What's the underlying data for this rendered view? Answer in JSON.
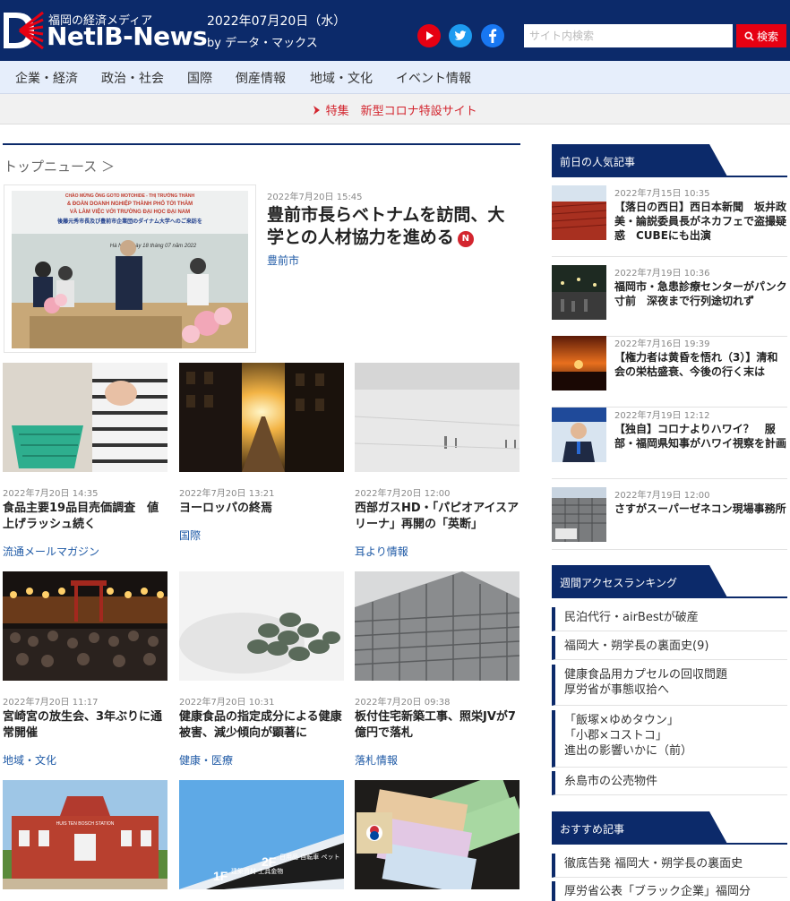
{
  "header": {
    "logo_sub": "福岡の経済メディア",
    "logo_main": "NetIB-News",
    "date": "2022年07月20日（水）",
    "by": "by データ・マックス",
    "search_placeholder": "サイト内検索",
    "search_button": "検索",
    "sns_icons": [
      "youtube-icon",
      "twitter-icon",
      "facebook-icon"
    ]
  },
  "nav": {
    "items": [
      "企業・経済",
      "政治・社会",
      "国際",
      "倒産情報",
      "地域・文化",
      "イベント情報"
    ]
  },
  "feature": {
    "label": "特集　新型コロナ特設サイト"
  },
  "main": {
    "section_title": "トップニュース ＞",
    "top_story": {
      "date": "2022年7月20日 15:45",
      "title": "豊前市長らベトナムを訪問、大学との人材協力を進める",
      "badge": "N",
      "category": "豊前市",
      "banner_line1": "CHÀO MỪNG ÔNG GOTO MOTOHIDE - THỊ TRƯỞNG THÀNH",
      "banner_line2": "& ĐOÀN DOANH NGHIỆP THÀNH PHỐ TỚI THĂM",
      "banner_line3": "VÀ LÀM VIỆC VỚI TRƯỜNG ĐẠI HỌC ĐẠI NAM",
      "banner_line4": "後藤元秀市長及び豊前市企業団のダイナム大学へのご来訪を",
      "banner_line5": "Hà Nội, ngày 18 tháng 07 năm 2022"
    },
    "cards": [
      {
        "date": "2022年7月20日 14:35",
        "title": "食品主要19品目売価調査　値上げラッシュ続く",
        "category": "流通メールマガジン"
      },
      {
        "date": "2022年7月20日 13:21",
        "title": "ヨーロッパの終焉",
        "category": "国際"
      },
      {
        "date": "2022年7月20日 12:00",
        "title": "西部ガスHD・「パピオアイスアリーナ」再開の「英断」",
        "category": "耳より情報"
      },
      {
        "date": "2022年7月20日 11:17",
        "title": "宮崎宮の放生会、3年ぶりに通常開催",
        "category": "地域・文化"
      },
      {
        "date": "2022年7月20日 10:31",
        "title": "健康食品の指定成分による健康被害、減少傾向が顕著に",
        "category": "健康・医療"
      },
      {
        "date": "2022年7月20日 09:38",
        "title": "板付住宅新築工事、照栄JVが7億円で落札",
        "category": "落札情報"
      }
    ],
    "bottom_card_texts": {
      "station_sign": "HUIS TEN BOSCH STATION",
      "store_sign_1f": "1F",
      "store_sign_1f_text": "建築資材 工具金物",
      "store_sign_2f": "2F",
      "store_sign_2f_text": "日用品 自転車 ペット"
    }
  },
  "sidebar": {
    "popular_title": "前日の人気記事",
    "popular": [
      {
        "date": "2022年7月15日 10:35",
        "title": "【落日の西日】西日本新聞　坂井政美・論説委員長がネカフェで盗撮疑惑　CUBEにも出演"
      },
      {
        "date": "2022年7月19日 10:36",
        "title": "福岡市・急患診療センターがパンク寸前　深夜まで行列途切れず"
      },
      {
        "date": "2022年7月16日 19:39",
        "title": "【権力者は黄昏を悟れ（3）】清和会の栄枯盛衰、今後の行く末は"
      },
      {
        "date": "2022年7月19日 12:12",
        "title": "【独自】コロナよりハワイ？　服部・福岡県知事がハワイ視察を計画"
      },
      {
        "date": "2022年7月19日 12:00",
        "title": "さすがスーパーゼネコン現場事務所"
      }
    ],
    "weekly_title": "週間アクセスランキング",
    "weekly": [
      {
        "lines": [
          "民泊代行・airBestが破産"
        ]
      },
      {
        "lines": [
          "福岡大・朔学長の裏面史(9)"
        ]
      },
      {
        "lines": [
          "健康食品用カプセルの回収問題",
          "厚労省が事態収拾へ"
        ]
      },
      {
        "lines": [
          "「飯塚×ゆめタウン」",
          "「小郡×コストコ」",
          "進出の影響いかに（前）"
        ]
      },
      {
        "lines": [
          "糸島市の公売物件"
        ]
      }
    ],
    "recommend_title": "おすすめ記事",
    "recommend": [
      {
        "lines": [
          "徹底告発 福岡大・朔学長の裏面史"
        ]
      },
      {
        "lines": [
          "厚労省公表「ブラック企業」福岡分"
        ]
      }
    ]
  },
  "colors": {
    "brand": "#0c2a6a",
    "accent": "#e60012",
    "link": "#1f5aa6"
  }
}
